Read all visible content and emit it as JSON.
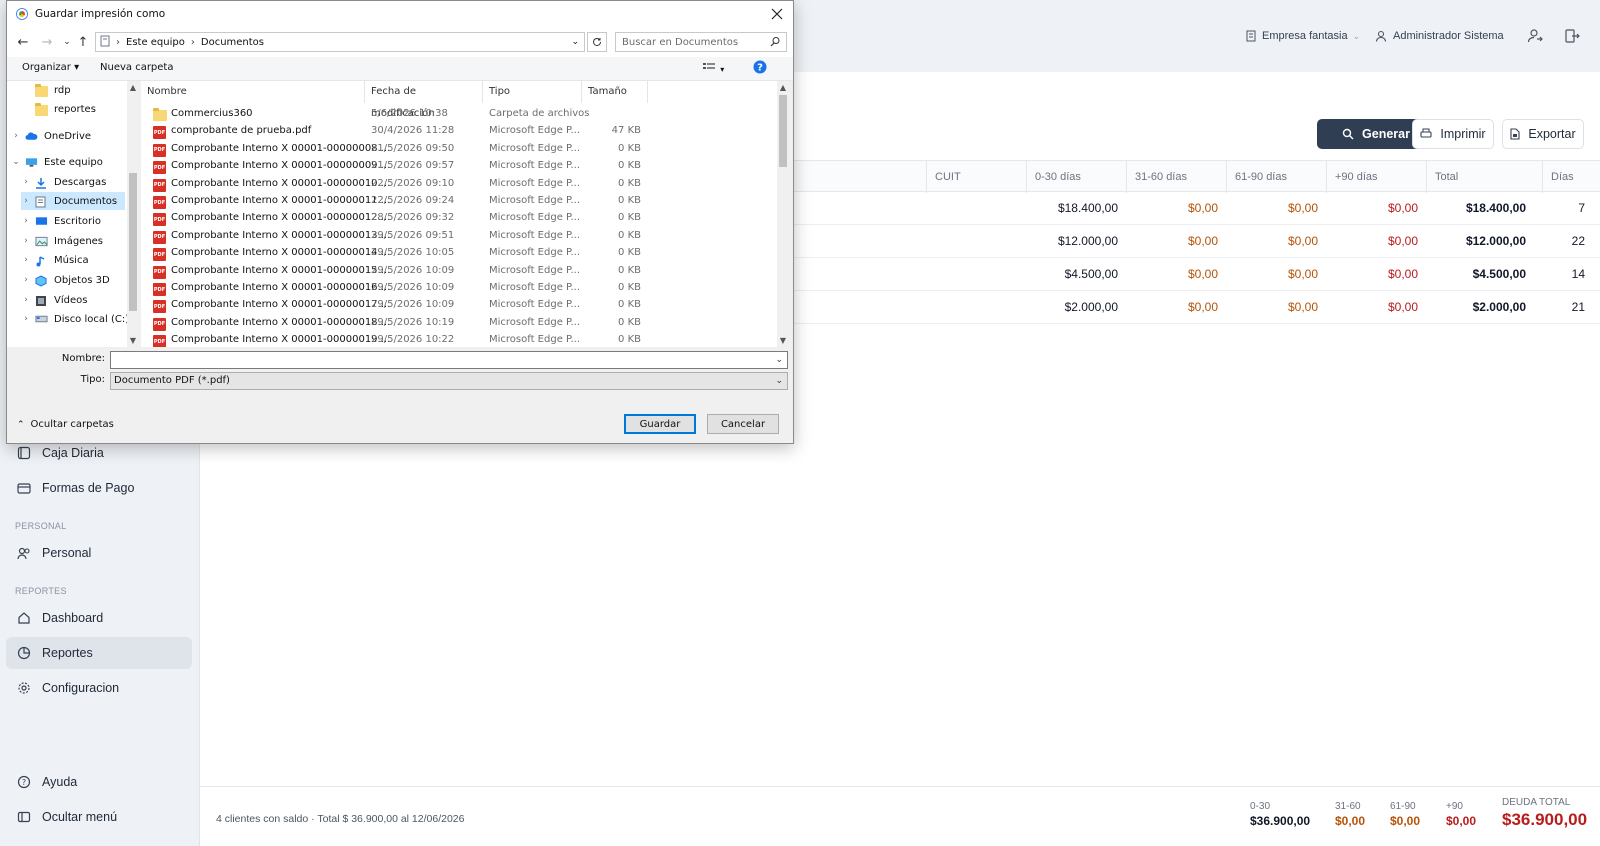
{
  "dialog": {
    "title": "Guardar impresión como",
    "breadcrumb": [
      "Este equipo",
      "Documentos"
    ],
    "search_placeholder": "Buscar en Documentos",
    "toolbar": {
      "organize": "Organizar",
      "new_folder": "Nueva carpeta"
    },
    "tree": [
      {
        "label": "rdp",
        "icon": "folder-icon"
      },
      {
        "label": "reportes",
        "icon": "folder-icon"
      },
      {
        "label": "OneDrive",
        "icon": "cloud-icon"
      },
      {
        "label": "Este equipo",
        "icon": "computer-icon"
      },
      {
        "label": "Descargas",
        "icon": "download-icon"
      },
      {
        "label": "Documentos",
        "icon": "document-icon"
      },
      {
        "label": "Escritorio",
        "icon": "desktop-icon"
      },
      {
        "label": "Imágenes",
        "icon": "image-icon"
      },
      {
        "label": "Música",
        "icon": "music-icon"
      },
      {
        "label": "Objetos 3D",
        "icon": "cube-icon"
      },
      {
        "label": "Vídeos",
        "icon": "video-icon"
      },
      {
        "label": "Disco local (C:)",
        "icon": "drive-icon"
      }
    ],
    "columns": [
      "Nombre",
      "Fecha de modificación",
      "Tipo",
      "Tamaño"
    ],
    "files": [
      {
        "name": "Commercius360",
        "date": "5/6/2026 10:38",
        "type": "Carpeta de archivos",
        "size": "",
        "icon": "folder"
      },
      {
        "name": "comprobante de prueba.pdf",
        "date": "30/4/2026 11:28",
        "type": "Microsoft Edge P...",
        "size": "47 KB",
        "icon": "pdf"
      },
      {
        "name": "Comprobante Interno X 00001-00000008....",
        "date": "21/5/2026 09:50",
        "type": "Microsoft Edge P...",
        "size": "0 KB",
        "icon": "pdf"
      },
      {
        "name": "Comprobante Interno X 00001-00000009....",
        "date": "21/5/2026 09:57",
        "type": "Microsoft Edge P...",
        "size": "0 KB",
        "icon": "pdf"
      },
      {
        "name": "Comprobante Interno X 00001-00000010....",
        "date": "22/5/2026 09:10",
        "type": "Microsoft Edge P...",
        "size": "0 KB",
        "icon": "pdf"
      },
      {
        "name": "Comprobante Interno X 00001-00000011....",
        "date": "22/5/2026 09:24",
        "type": "Microsoft Edge P...",
        "size": "0 KB",
        "icon": "pdf"
      },
      {
        "name": "Comprobante Interno X 00001-00000012....",
        "date": "28/5/2026 09:32",
        "type": "Microsoft Edge P...",
        "size": "0 KB",
        "icon": "pdf"
      },
      {
        "name": "Comprobante Interno X 00001-00000013....",
        "date": "29/5/2026 09:51",
        "type": "Microsoft Edge P...",
        "size": "0 KB",
        "icon": "pdf"
      },
      {
        "name": "Comprobante Interno X 00001-00000014....",
        "date": "29/5/2026 10:05",
        "type": "Microsoft Edge P...",
        "size": "0 KB",
        "icon": "pdf"
      },
      {
        "name": "Comprobante Interno X 00001-00000015....",
        "date": "29/5/2026 10:09",
        "type": "Microsoft Edge P...",
        "size": "0 KB",
        "icon": "pdf"
      },
      {
        "name": "Comprobante Interno X 00001-00000016....",
        "date": "29/5/2026 10:09",
        "type": "Microsoft Edge P...",
        "size": "0 KB",
        "icon": "pdf"
      },
      {
        "name": "Comprobante Interno X 00001-00000017....",
        "date": "29/5/2026 10:09",
        "type": "Microsoft Edge P...",
        "size": "0 KB",
        "icon": "pdf"
      },
      {
        "name": "Comprobante Interno X 00001-00000018....",
        "date": "29/5/2026 10:19",
        "type": "Microsoft Edge P...",
        "size": "0 KB",
        "icon": "pdf"
      },
      {
        "name": "Comprobante Interno X 00001-00000019....",
        "date": "29/5/2026 10:22",
        "type": "Microsoft Edge P...",
        "size": "0 KB",
        "icon": "pdf"
      }
    ],
    "name_label": "Nombre:",
    "name_value": "",
    "type_label": "Tipo:",
    "type_value": "Documento PDF (*.pdf)",
    "hide_folders": "Ocultar carpetas",
    "save": "Guardar",
    "cancel": "Cancelar"
  },
  "header": {
    "company": "Empresa fantasia",
    "user": "Administrador Sistema"
  },
  "actions": {
    "generate": "Generar",
    "print": "Imprimir",
    "export": "Exportar"
  },
  "sidebar": {
    "items": [
      {
        "label": "Caja Diaria",
        "icon": "cash-register-icon"
      },
      {
        "label": "Formas de Pago",
        "icon": "credit-card-icon"
      }
    ],
    "section_personal": "PERSONAL",
    "personal_items": [
      {
        "label": "Personal",
        "icon": "users-icon"
      }
    ],
    "section_reports": "REPORTES",
    "report_items": [
      {
        "label": "Dashboard",
        "icon": "home-icon"
      },
      {
        "label": "Reportes",
        "icon": "report-icon"
      },
      {
        "label": "Configuracion",
        "icon": "gear-icon"
      }
    ],
    "help": "Ayuda",
    "hide_menu": "Ocultar menú"
  },
  "table": {
    "columns": [
      "CUIT",
      "0-30 días",
      "31-60 días",
      "61-90 días",
      "+90 días",
      "Total",
      "Días"
    ],
    "rows": [
      {
        "d0_30": "$18.400,00",
        "d31_60": "$0,00",
        "d61_90": "$0,00",
        "d90p": "$0,00",
        "total": "$18.400,00",
        "days": "7"
      },
      {
        "d0_30": "$12.000,00",
        "d31_60": "$0,00",
        "d61_90": "$0,00",
        "d90p": "$0,00",
        "total": "$12.000,00",
        "days": "22"
      },
      {
        "d0_30": "$4.500,00",
        "d31_60": "$0,00",
        "d61_90": "$0,00",
        "d90p": "$0,00",
        "total": "$4.500,00",
        "days": "14"
      },
      {
        "d0_30": "$2.000,00",
        "d31_60": "$0,00",
        "d61_90": "$0,00",
        "d90p": "$0,00",
        "total": "$2.000,00",
        "days": "21"
      }
    ]
  },
  "footer": {
    "summary": "4 clientes con saldo · Total $ 36.900,00 al 12/06/2026",
    "b0_30_label": "0-30",
    "b0_30_value": "$36.900,00",
    "b31_60_label": "31-60",
    "b31_60_value": "$0,00",
    "b61_90_label": "61-90",
    "b61_90_value": "$0,00",
    "b90_label": "+90",
    "b90_value": "$0,00",
    "total_label": "DEUDA TOTAL",
    "total_value": "$36.900,00"
  },
  "colors": {
    "accent_dark": "#2f3e52",
    "debt_red": "#b91c1c",
    "aging_orange": "#b45309"
  }
}
